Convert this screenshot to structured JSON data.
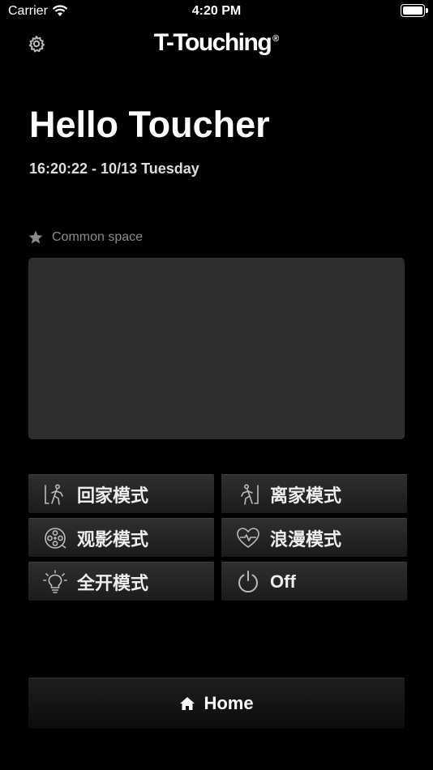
{
  "status_bar": {
    "carrier": "Carrier",
    "time": "4:20 PM"
  },
  "header": {
    "logo": "T-Touching",
    "logo_mark": "®"
  },
  "greeting": "Hello Toucher",
  "datetime": "16:20:22 - 10/13 Tuesday",
  "common_space": {
    "label": "Common space"
  },
  "modes": [
    {
      "label": "回家模式",
      "icon": "arrive-home-icon"
    },
    {
      "label": "离家模式",
      "icon": "leave-home-icon"
    },
    {
      "label": "观影模式",
      "icon": "film-reel-icon"
    },
    {
      "label": "浪漫模式",
      "icon": "heart-icon"
    },
    {
      "label": "全开模式",
      "icon": "light-bulb-icon"
    },
    {
      "label": "Off",
      "icon": "power-icon"
    }
  ],
  "home_button": {
    "label": "Home",
    "icon": "home-icon"
  },
  "colors": {
    "background": "#000000",
    "panel": "#2e2e2e",
    "button": "#262626"
  }
}
